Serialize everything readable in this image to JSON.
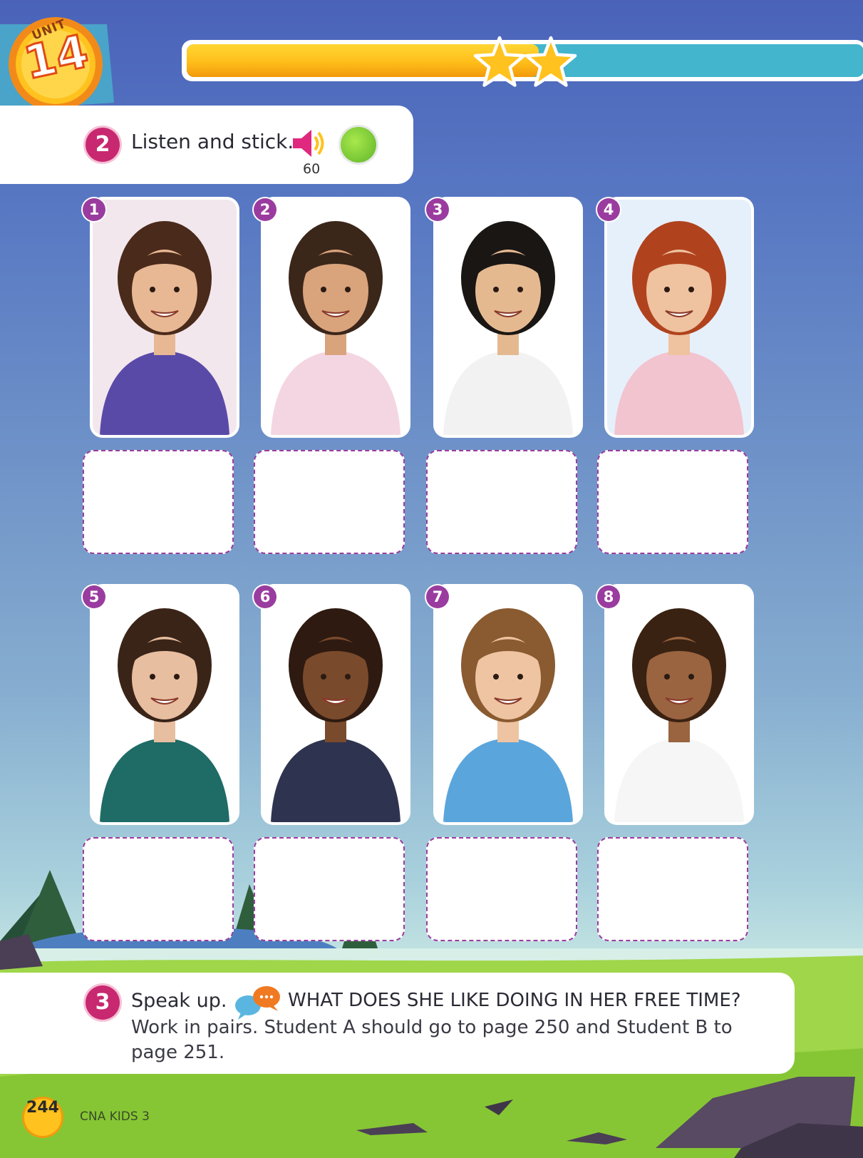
{
  "unit": {
    "label": "UNIT",
    "number": "14"
  },
  "progress": {
    "fill_fraction": 0.52,
    "stars": 2
  },
  "exercise2": {
    "number": "2",
    "title": "Listen and stick.",
    "audio_track": "60",
    "icons": [
      "speaker-icon",
      "sticker-icon"
    ],
    "cards": [
      {
        "number": "1",
        "photo": "boy-glasses-plaid-shirt"
      },
      {
        "number": "2",
        "photo": "girl-headband-pink-top"
      },
      {
        "number": "3",
        "photo": "young-man-raglan-tee"
      },
      {
        "number": "4",
        "photo": "woman-red-hair-pink-top"
      },
      {
        "number": "5",
        "photo": "young-woman-green-top"
      },
      {
        "number": "6",
        "photo": "boy-curly-hair-tie"
      },
      {
        "number": "7",
        "photo": "boy-blue-tshirt"
      },
      {
        "number": "8",
        "photo": "woman-curly-hair-white-top"
      }
    ]
  },
  "exercise3": {
    "number": "3",
    "title": "Speak up.",
    "question": "WHAT DOES SHE LIKE DOING IN HER FREE TIME?",
    "instructions": "Work in pairs. Student A should go to page 250 and Student B to page 251.",
    "icons": [
      "chat-bubbles-icon"
    ]
  },
  "footer": {
    "page_number": "244",
    "book_title": "CNA KIDS 3"
  },
  "colors": {
    "accent_magenta": "#c8286f",
    "card_number_purple": "#9a3c9f",
    "sky_blue": "#4a63b9",
    "grass_green": "#8ccc38"
  }
}
